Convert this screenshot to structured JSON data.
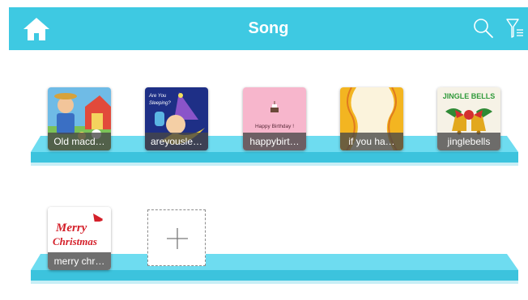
{
  "header": {
    "title": "Song",
    "home_icon": "home-icon",
    "search_icon": "search-icon",
    "filter_icon": "filter-icon",
    "background_color": "#3ec9e2"
  },
  "shelf_color": "#6edcf0",
  "songs": [
    {
      "label": "Old macd…",
      "art": "old-macdonald-cover"
    },
    {
      "label": "areyousle…",
      "art": "are-you-sleeping-cover",
      "art_text_1": "Are You",
      "art_text_2": "Sleeping?"
    },
    {
      "label": "happybirt…",
      "art": "happy-birthday-cover",
      "art_text": "Happy Birthday !"
    },
    {
      "label": "if you ha…",
      "art": "if-you-happy-cover"
    },
    {
      "label": "jinglebells",
      "art": "jingle-bells-cover",
      "art_text": "JINGLE BELLS"
    },
    {
      "label": "merry chr…",
      "art": "merry-christmas-cover",
      "art_text_1": "Merry",
      "art_text_2": "Christmas"
    }
  ],
  "add_tile": {
    "icon": "plus-icon"
  }
}
